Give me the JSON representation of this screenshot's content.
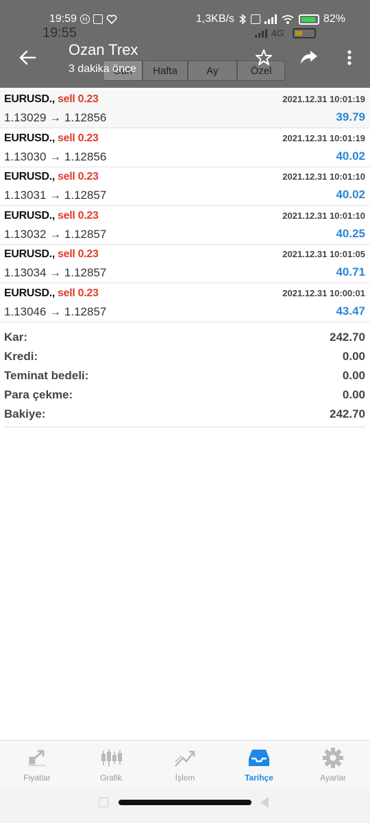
{
  "status_bar": {
    "time": "19:59",
    "speed": "1,3KB/s",
    "battery": "82%"
  },
  "underlay": {
    "time": "19:55",
    "network": "4G",
    "tabs": [
      "Gün",
      "Hafta",
      "Ay",
      "Özel"
    ]
  },
  "app_bar": {
    "title": "Ozan Trex",
    "subtitle": "3 dakika önce"
  },
  "trades": [
    {
      "symbol": "EURUSD.,",
      "side": "sell 0.23",
      "prices": "1.13029 → 1.12856",
      "time": "2021.12.31 10:01:19",
      "profit": "39.79"
    },
    {
      "symbol": "EURUSD.,",
      "side": "sell 0.23",
      "prices": "1.13030 → 1.12856",
      "time": "2021.12.31 10:01:19",
      "profit": "40.02"
    },
    {
      "symbol": "EURUSD.,",
      "side": "sell 0.23",
      "prices": "1.13031 → 1.12857",
      "time": "2021.12.31 10:01:10",
      "profit": "40.02"
    },
    {
      "symbol": "EURUSD.,",
      "side": "sell 0.23",
      "prices": "1.13032 → 1.12857",
      "time": "2021.12.31 10:01:10",
      "profit": "40.25"
    },
    {
      "symbol": "EURUSD.,",
      "side": "sell 0.23",
      "prices": "1.13034 → 1.12857",
      "time": "2021.12.31 10:01:05",
      "profit": "40.71"
    },
    {
      "symbol": "EURUSD.,",
      "side": "sell 0.23",
      "prices": "1.13046 → 1.12857",
      "time": "2021.12.31 10:00:01",
      "profit": "43.47"
    }
  ],
  "summary": [
    {
      "label": "Kar:",
      "value": "242.70"
    },
    {
      "label": "Kredi:",
      "value": "0.00"
    },
    {
      "label": "Teminat bedeli:",
      "value": "0.00"
    },
    {
      "label": "Para çekme:",
      "value": "0.00"
    },
    {
      "label": "Bakiye:",
      "value": "242.70"
    }
  ],
  "nav": [
    {
      "label": "Fiyatlar",
      "icon": "quotes-icon"
    },
    {
      "label": "Grafik",
      "icon": "candlestick-icon"
    },
    {
      "label": "İşlem",
      "icon": "trade-icon"
    },
    {
      "label": "Tarihçe",
      "icon": "history-icon"
    },
    {
      "label": "Ayarlar",
      "icon": "gear-icon"
    }
  ],
  "colors": {
    "sell": "#e03b2b",
    "profit": "#2a86d4",
    "nav_active": "#1e88e5",
    "header_overlay": "#6c6c6c"
  }
}
